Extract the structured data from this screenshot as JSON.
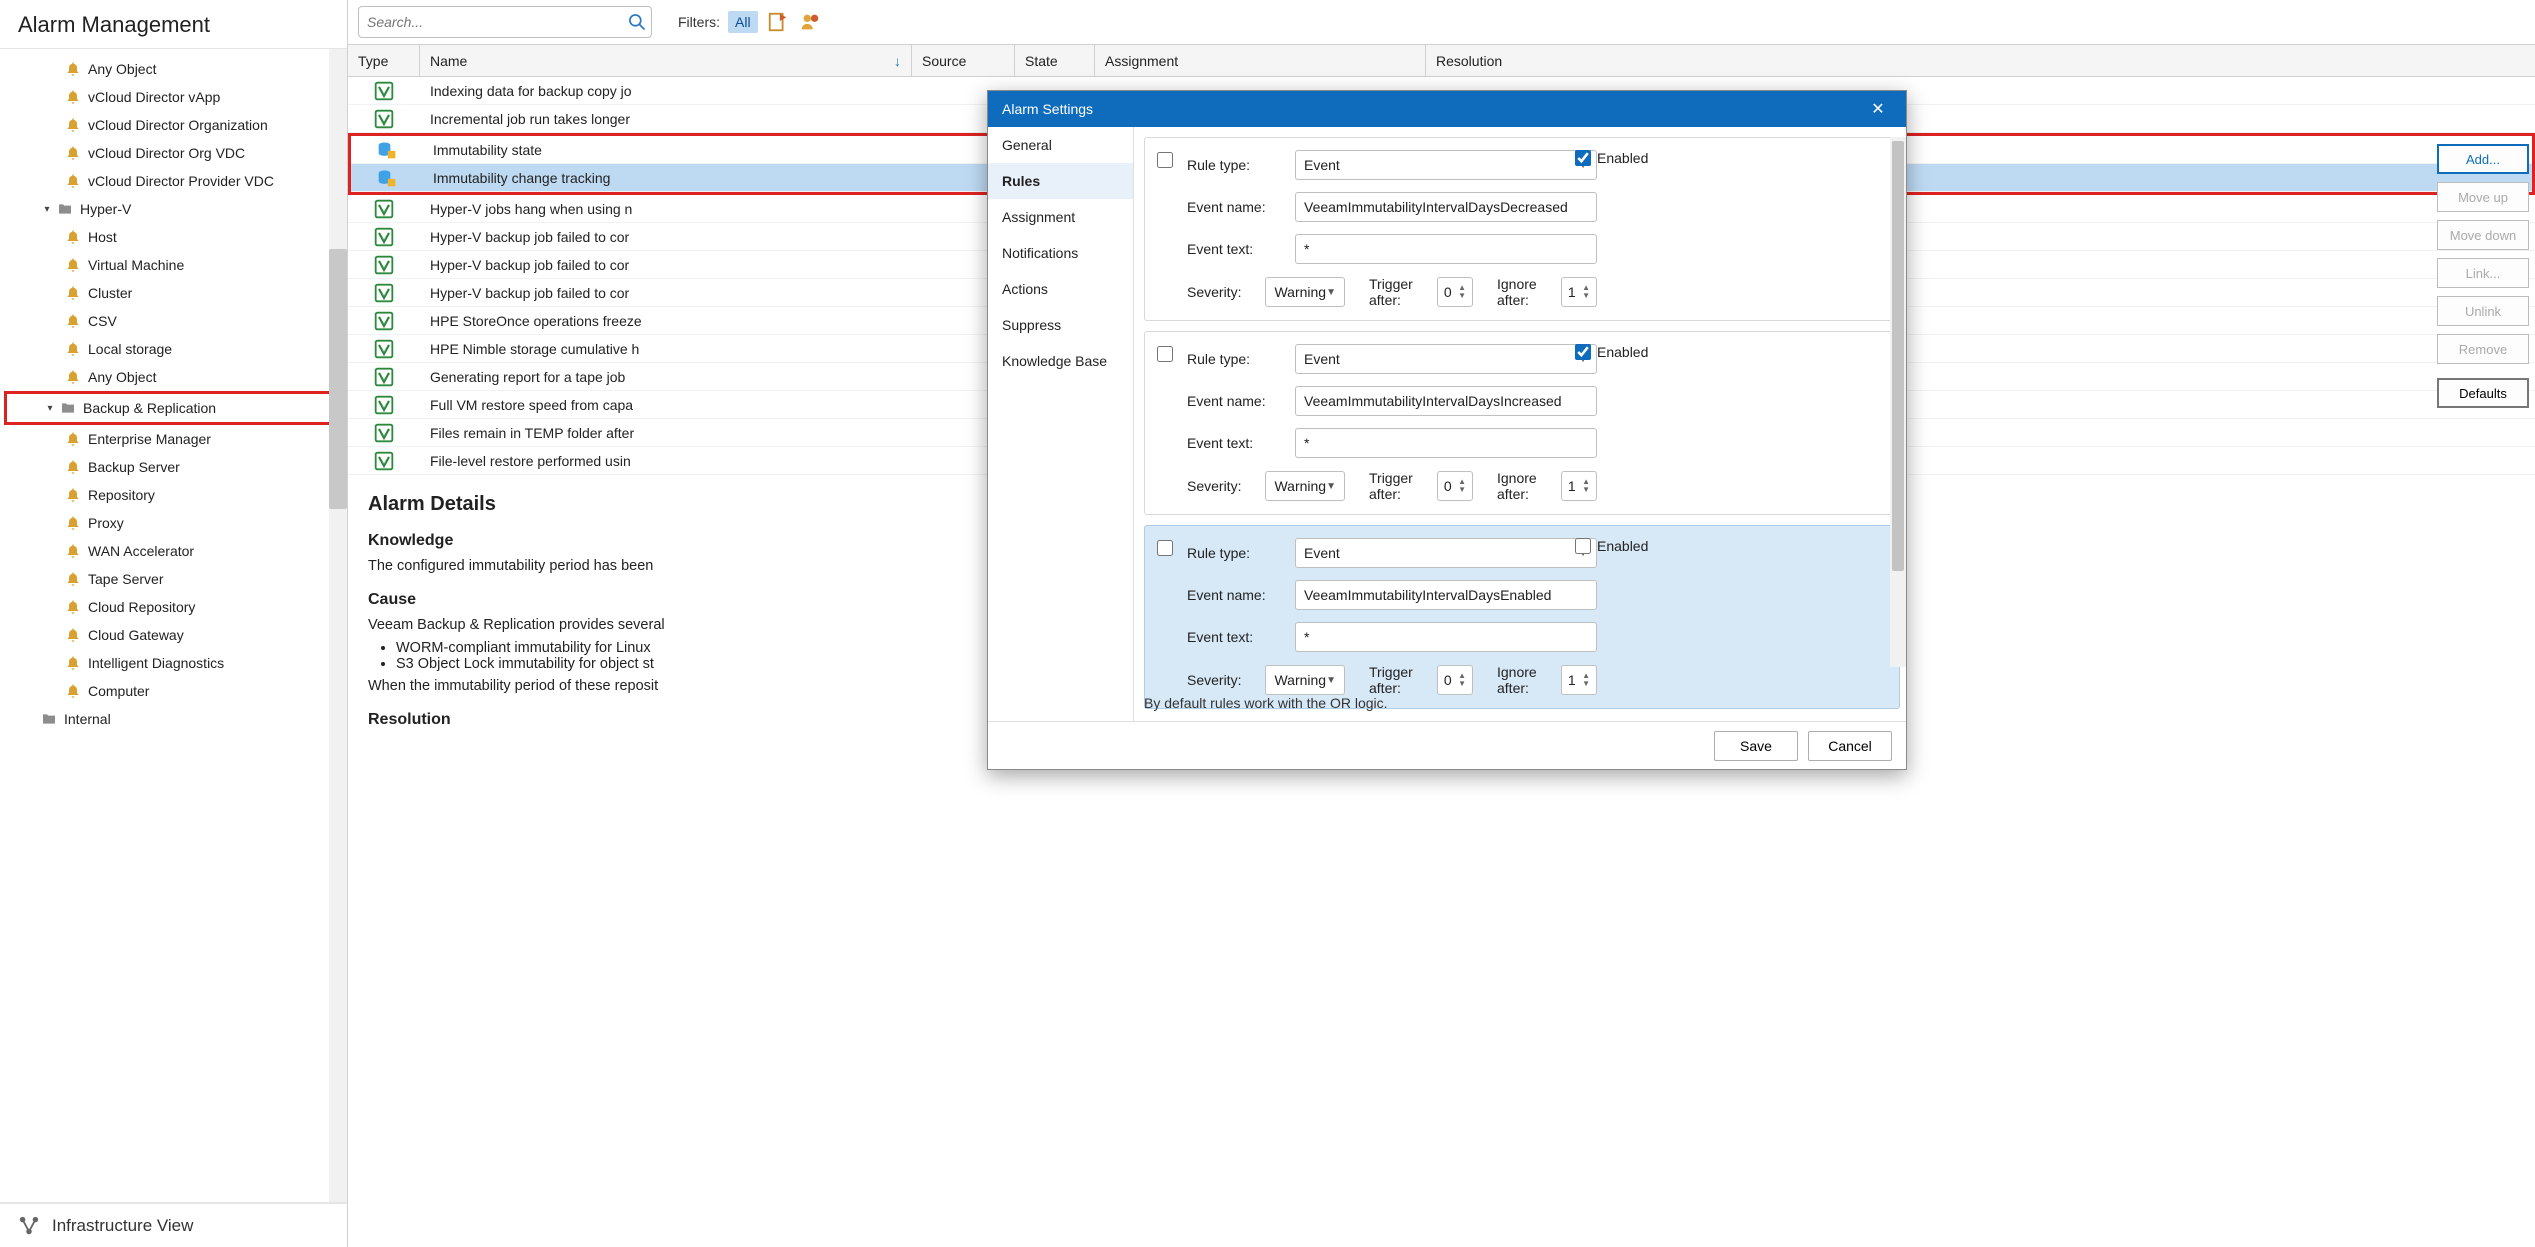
{
  "nav": {
    "title": "Alarm Management",
    "items": [
      {
        "label": "Any Object",
        "level": 2,
        "partial": true
      },
      {
        "label": "vCloud Director vApp",
        "level": 2
      },
      {
        "label": "vCloud Director Organization",
        "level": 2
      },
      {
        "label": "vCloud Director Org VDC",
        "level": 2
      },
      {
        "label": "vCloud Director Provider VDC",
        "level": 2
      },
      {
        "label": "Hyper-V",
        "level": 1,
        "expandable": true,
        "expanded": true,
        "folder": true
      },
      {
        "label": "Host",
        "level": 2
      },
      {
        "label": "Virtual Machine",
        "level": 2
      },
      {
        "label": "Cluster",
        "level": 2
      },
      {
        "label": "CSV",
        "level": 2
      },
      {
        "label": "Local storage",
        "level": 2
      },
      {
        "label": "Any Object",
        "level": 2
      },
      {
        "label": "Backup & Replication",
        "level": 1,
        "expandable": true,
        "expanded": true,
        "folder": true,
        "highlight": true
      },
      {
        "label": "Enterprise Manager",
        "level": 2
      },
      {
        "label": "Backup Server",
        "level": 2
      },
      {
        "label": "Repository",
        "level": 2
      },
      {
        "label": "Proxy",
        "level": 2
      },
      {
        "label": "WAN Accelerator",
        "level": 2
      },
      {
        "label": "Tape Server",
        "level": 2
      },
      {
        "label": "Cloud Repository",
        "level": 2
      },
      {
        "label": "Cloud Gateway",
        "level": 2
      },
      {
        "label": "Intelligent Diagnostics",
        "level": 2
      },
      {
        "label": "Computer",
        "level": 2
      },
      {
        "label": "Internal",
        "level": 1,
        "folder": true
      }
    ],
    "bottom_view": "Infrastructure View"
  },
  "toolbar": {
    "search_placeholder": "Search...",
    "filters_label": "Filters:",
    "filter_all": "All"
  },
  "columns": {
    "type": "Type",
    "name": "Name",
    "source": "Source",
    "state": "State",
    "assignment": "Assignment",
    "resolution": "Resolution"
  },
  "alarms": [
    {
      "icon": "veeam",
      "name": "Indexing data for backup copy jo"
    },
    {
      "icon": "veeam",
      "name": "Incremental job run takes longer"
    },
    {
      "icon": "repo",
      "name": "Immutability state",
      "box": "start"
    },
    {
      "icon": "repo",
      "name": "Immutability change tracking",
      "box": "end",
      "selected": true
    },
    {
      "icon": "veeam",
      "name": "Hyper-V jobs hang when using n"
    },
    {
      "icon": "veeam",
      "name": "Hyper-V backup job failed to cor"
    },
    {
      "icon": "veeam",
      "name": "Hyper-V backup job failed to cor"
    },
    {
      "icon": "veeam",
      "name": "Hyper-V backup job failed to cor"
    },
    {
      "icon": "veeam",
      "name": "HPE StoreOnce operations freeze"
    },
    {
      "icon": "veeam",
      "name": "HPE Nimble storage cumulative h"
    },
    {
      "icon": "veeam",
      "name": "Generating report for a tape job"
    },
    {
      "icon": "veeam",
      "name": "Full VM restore speed from capa"
    },
    {
      "icon": "veeam",
      "name": "Files remain in TEMP folder after"
    },
    {
      "icon": "veeam",
      "name": "File-level restore performed usin"
    }
  ],
  "details": {
    "title": "Alarm Details",
    "knowledge_h": "Knowledge",
    "knowledge_p": "The configured immutability period has been",
    "cause_h": "Cause",
    "cause_p": "Veeam Backup & Replication provides several",
    "cause_b1": "WORM-compliant immutability for Linux",
    "cause_b2": "S3 Object Lock immutability for object st",
    "cause_p2": "When the immutability period of these reposit",
    "resolution_h": "Resolution"
  },
  "dialog": {
    "title": "Alarm Settings",
    "nav": [
      "General",
      "Rules",
      "Assignment",
      "Notifications",
      "Actions",
      "Suppress",
      "Knowledge Base"
    ],
    "selected_nav": 1,
    "footer_note": "By default rules work with the OR logic.",
    "save": "Save",
    "cancel": "Cancel",
    "labels": {
      "rule_type": "Rule type:",
      "event_name": "Event name:",
      "event_text": "Event text:",
      "severity": "Severity:",
      "trigger_after": "Trigger after:",
      "ignore_after": "Ignore after:",
      "enabled": "Enabled"
    },
    "rules": [
      {
        "rule_type": "Event",
        "event_name": "VeeamImmutabilityIntervalDaysDecreased",
        "event_text": "*",
        "severity": "Warning",
        "trigger_after": 0,
        "ignore_after": 1,
        "enabled": true
      },
      {
        "rule_type": "Event",
        "event_name": "VeeamImmutabilityIntervalDaysIncreased",
        "event_text": "*",
        "severity": "Warning",
        "trigger_after": 0,
        "ignore_after": 1,
        "enabled": true
      },
      {
        "rule_type": "Event",
        "event_name": "VeeamImmutabilityIntervalDaysEnabled",
        "event_text": "*",
        "severity": "Warning",
        "trigger_after": 0,
        "ignore_after": 1,
        "enabled": false,
        "selected": true
      }
    ],
    "side_buttons": {
      "add": "Add...",
      "move_up": "Move up",
      "move_down": "Move down",
      "link": "Link...",
      "unlink": "Unlink",
      "remove": "Remove",
      "defaults": "Defaults"
    }
  }
}
